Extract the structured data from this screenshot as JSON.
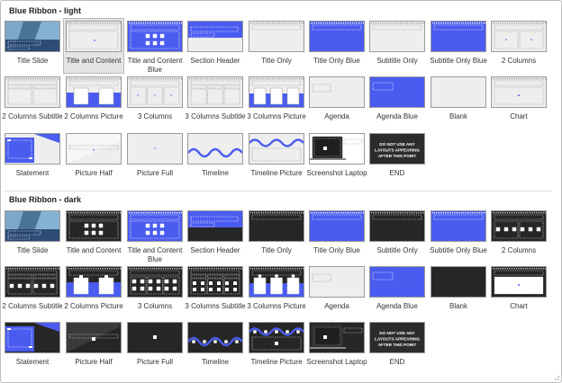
{
  "colors": {
    "accent": "#4a5cf0",
    "dark": "#262626",
    "light": "#eeeeee",
    "label": "#333333"
  },
  "sections": [
    {
      "title": "Blue Ribbon - light",
      "theme": "light",
      "layouts": [
        {
          "label": "Title Slide",
          "kind": "title-slide"
        },
        {
          "label": "Title and Content",
          "kind": "title-content",
          "selected": true
        },
        {
          "label": "Title and Content Blue",
          "kind": "title-content-blue"
        },
        {
          "label": "Section Header",
          "kind": "section-header"
        },
        {
          "label": "Title Only",
          "kind": "title-only"
        },
        {
          "label": "Title Only Blue",
          "kind": "title-only-blue"
        },
        {
          "label": "Subtitle Only",
          "kind": "subtitle-only"
        },
        {
          "label": "Subtitle Only Blue",
          "kind": "subtitle-only-blue"
        },
        {
          "label": "2 Columns",
          "kind": "two-columns"
        },
        {
          "label": "2 Columns Subtitle",
          "kind": "two-columns-subtitle"
        },
        {
          "label": "2 Columns Picture",
          "kind": "two-columns-picture"
        },
        {
          "label": "3 Columns",
          "kind": "three-columns"
        },
        {
          "label": "3 Columns Subtitle",
          "kind": "three-columns-subtitle"
        },
        {
          "label": "3 Columns Picture",
          "kind": "three-columns-picture"
        },
        {
          "label": "Agenda",
          "kind": "agenda"
        },
        {
          "label": "Agenda Blue",
          "kind": "agenda-blue"
        },
        {
          "label": "Blank",
          "kind": "blank"
        },
        {
          "label": "Chart",
          "kind": "chart"
        },
        {
          "label": "Statement",
          "kind": "statement"
        },
        {
          "label": "Picture Half",
          "kind": "picture-half"
        },
        {
          "label": "Picture Full",
          "kind": "picture-full"
        },
        {
          "label": "Timeline",
          "kind": "timeline"
        },
        {
          "label": "Timeline Picture",
          "kind": "timeline-picture"
        },
        {
          "label": "Screenshot Laptop",
          "kind": "screenshot-laptop"
        },
        {
          "label": "END",
          "kind": "end"
        }
      ]
    },
    {
      "title": "Blue Ribbon - dark",
      "theme": "dark",
      "layouts": [
        {
          "label": "Title Slide",
          "kind": "title-slide"
        },
        {
          "label": "Title and Content",
          "kind": "title-content"
        },
        {
          "label": "Title and Content Blue",
          "kind": "title-content-blue"
        },
        {
          "label": "Section Header",
          "kind": "section-header"
        },
        {
          "label": "Title Only",
          "kind": "title-only"
        },
        {
          "label": "Title Only Blue",
          "kind": "title-only-blue"
        },
        {
          "label": "Subtitle Only",
          "kind": "subtitle-only"
        },
        {
          "label": "Subtitle Only Blue",
          "kind": "subtitle-only-blue"
        },
        {
          "label": "2 Columns",
          "kind": "two-columns"
        },
        {
          "label": "2 Columns Subtitle",
          "kind": "two-columns-subtitle"
        },
        {
          "label": "2 Columns Picture",
          "kind": "two-columns-picture"
        },
        {
          "label": "3 Columns",
          "kind": "three-columns"
        },
        {
          "label": "3 Columns Subtitle",
          "kind": "three-columns-subtitle"
        },
        {
          "label": "3 Columns Picture",
          "kind": "three-columns-picture"
        },
        {
          "label": "Agenda",
          "kind": "agenda"
        },
        {
          "label": "Agenda Blue",
          "kind": "agenda-blue"
        },
        {
          "label": "Blank",
          "kind": "blank"
        },
        {
          "label": "Chart",
          "kind": "chart"
        },
        {
          "label": "Statement",
          "kind": "statement"
        },
        {
          "label": "Picture Half",
          "kind": "picture-half"
        },
        {
          "label": "Picture Full",
          "kind": "picture-full"
        },
        {
          "label": "Timeline",
          "kind": "timeline"
        },
        {
          "label": "Timeline Picture",
          "kind": "timeline-picture"
        },
        {
          "label": "Screenshot Laptop",
          "kind": "screenshot-laptop"
        },
        {
          "label": "END",
          "kind": "end"
        }
      ]
    }
  ],
  "end_slide_text": [
    "DO NOT USE ANY",
    "LAYOUTS APPEARING",
    "AFTER THIS POINT"
  ]
}
